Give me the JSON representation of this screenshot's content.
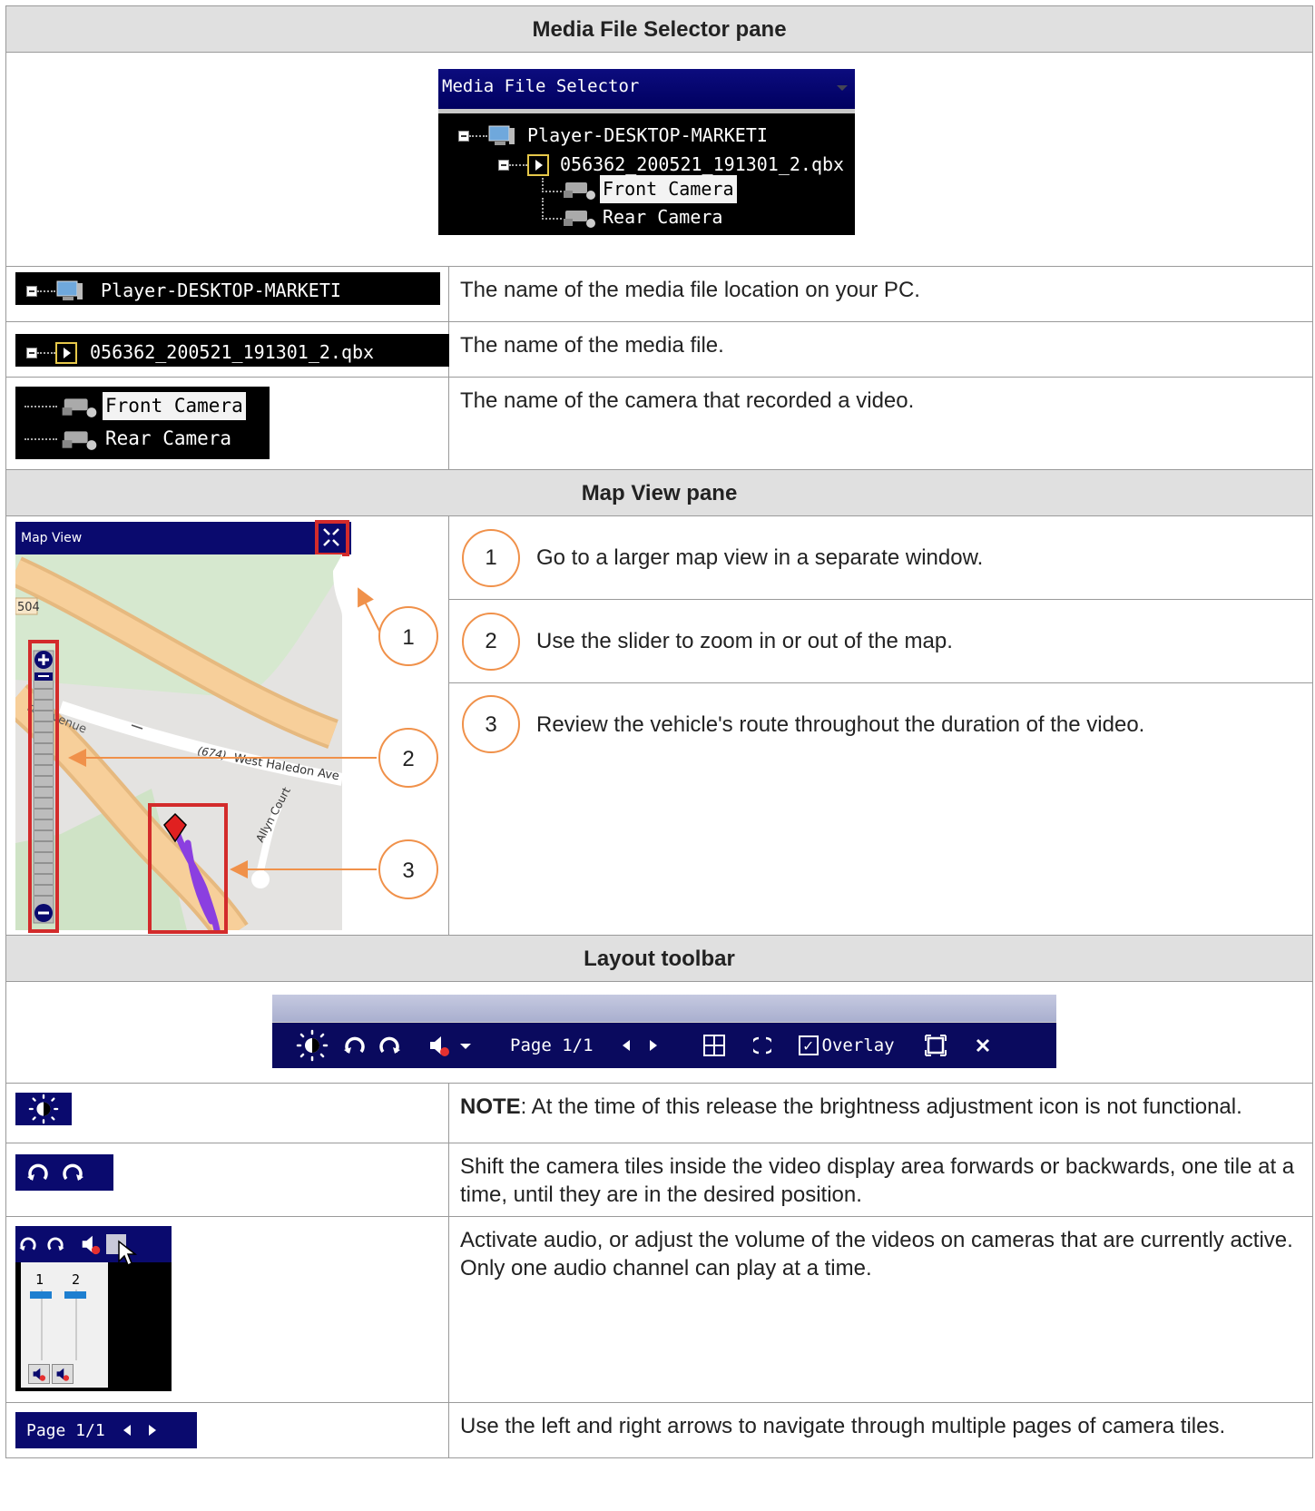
{
  "sections": {
    "media_file_selector": {
      "header": "Media File Selector pane",
      "screenshot_title": "Media File Selector",
      "tree": {
        "player": "Player-DESKTOP-MARKETI",
        "file": "056362_200521_191301_2.qbx",
        "front_camera": "Front Camera",
        "rear_camera": "Rear Camera"
      },
      "rows": [
        {
          "label": "Player-DESKTOP-MARKETI",
          "description": "The name of the media file location on your PC."
        },
        {
          "label": "056362_200521_191301_2.qbx",
          "description": "The name of the media file."
        },
        {
          "label_1": "Front Camera",
          "label_2": "Rear Camera",
          "description": "The name of the camera that recorded a video."
        }
      ]
    },
    "map_view": {
      "header": "Map View pane",
      "screenshot_title": "Map View",
      "map_labels": {
        "road_number": "504",
        "avenue": "ral Avenue",
        "route": "(674)",
        "west_haledon": "West Haledon Ave",
        "allyn": "Allyn Court"
      },
      "items": [
        {
          "number": "1",
          "text": "Go to a larger map view in a separate window."
        },
        {
          "number": "2",
          "text": "Use the slider to zoom in or out of the map."
        },
        {
          "number": "3",
          "text": "Review the vehicle's route throughout the duration of the video."
        }
      ]
    },
    "layout_toolbar": {
      "header": "Layout toolbar",
      "toolbar": {
        "page": "Page 1/1",
        "overlay": "Overlay"
      },
      "rows": [
        {
          "note_label": "NOTE",
          "description": ": At the time of this release the brightness adjustment icon is not functional."
        },
        {
          "description": "Shift the camera tiles inside the video display area forwards or backwards, one tile at a time, until they are in the desired position."
        },
        {
          "channel_1": "1",
          "channel_2": "2",
          "description": "Activate audio, or adjust the volume of the videos on cameras that are currently active. Only one audio channel can play at a time."
        },
        {
          "page": "Page 1/1",
          "description": "Use the left and right arrows to navigate through multiple pages of camera tiles."
        }
      ]
    }
  }
}
